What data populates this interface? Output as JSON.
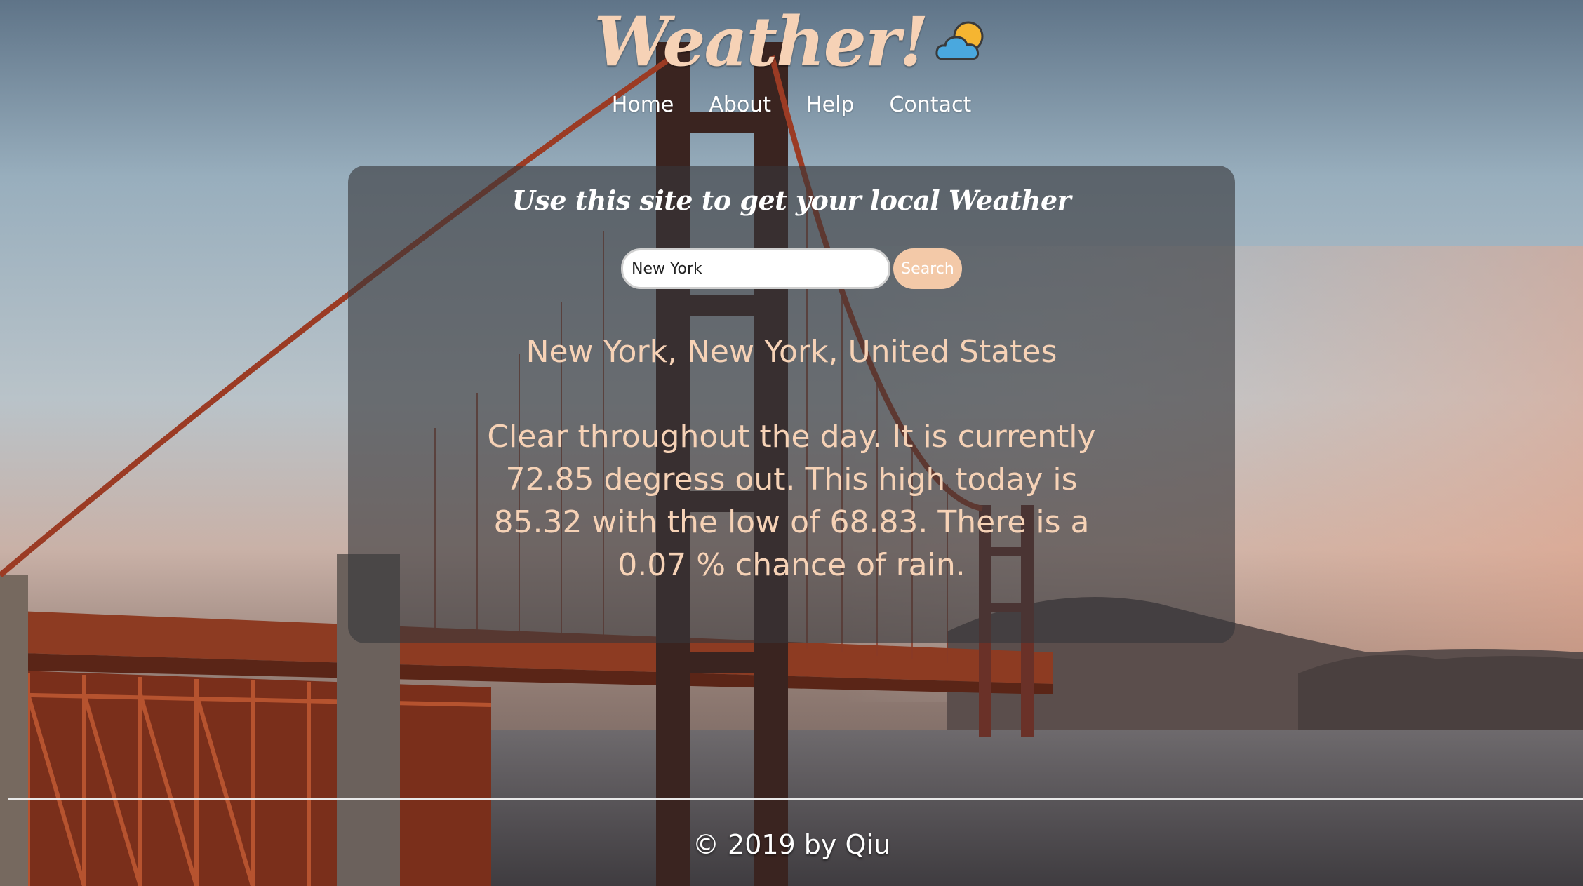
{
  "header": {
    "title": "Weather!",
    "icon": "partly-cloudy-icon"
  },
  "nav": {
    "items": [
      {
        "label": "Home"
      },
      {
        "label": "About"
      },
      {
        "label": "Help"
      },
      {
        "label": "Contact"
      }
    ]
  },
  "main": {
    "tagline": "Use this site to get your local Weather",
    "search": {
      "value": "New York",
      "placeholder": "",
      "button_label": "Search"
    },
    "result": {
      "location": "New York, New York, United States",
      "forecast": "Clear throughout the day. It is currently 72.85 degress out. This high today is 85.32 with the low of 68.83. There is a 0.07 % chance of rain."
    }
  },
  "footer": {
    "copyright": "© 2019 by Qiu"
  },
  "colors": {
    "accent": "#f6d2b6",
    "button": "#f3c9a8",
    "panel": "#37373a"
  }
}
